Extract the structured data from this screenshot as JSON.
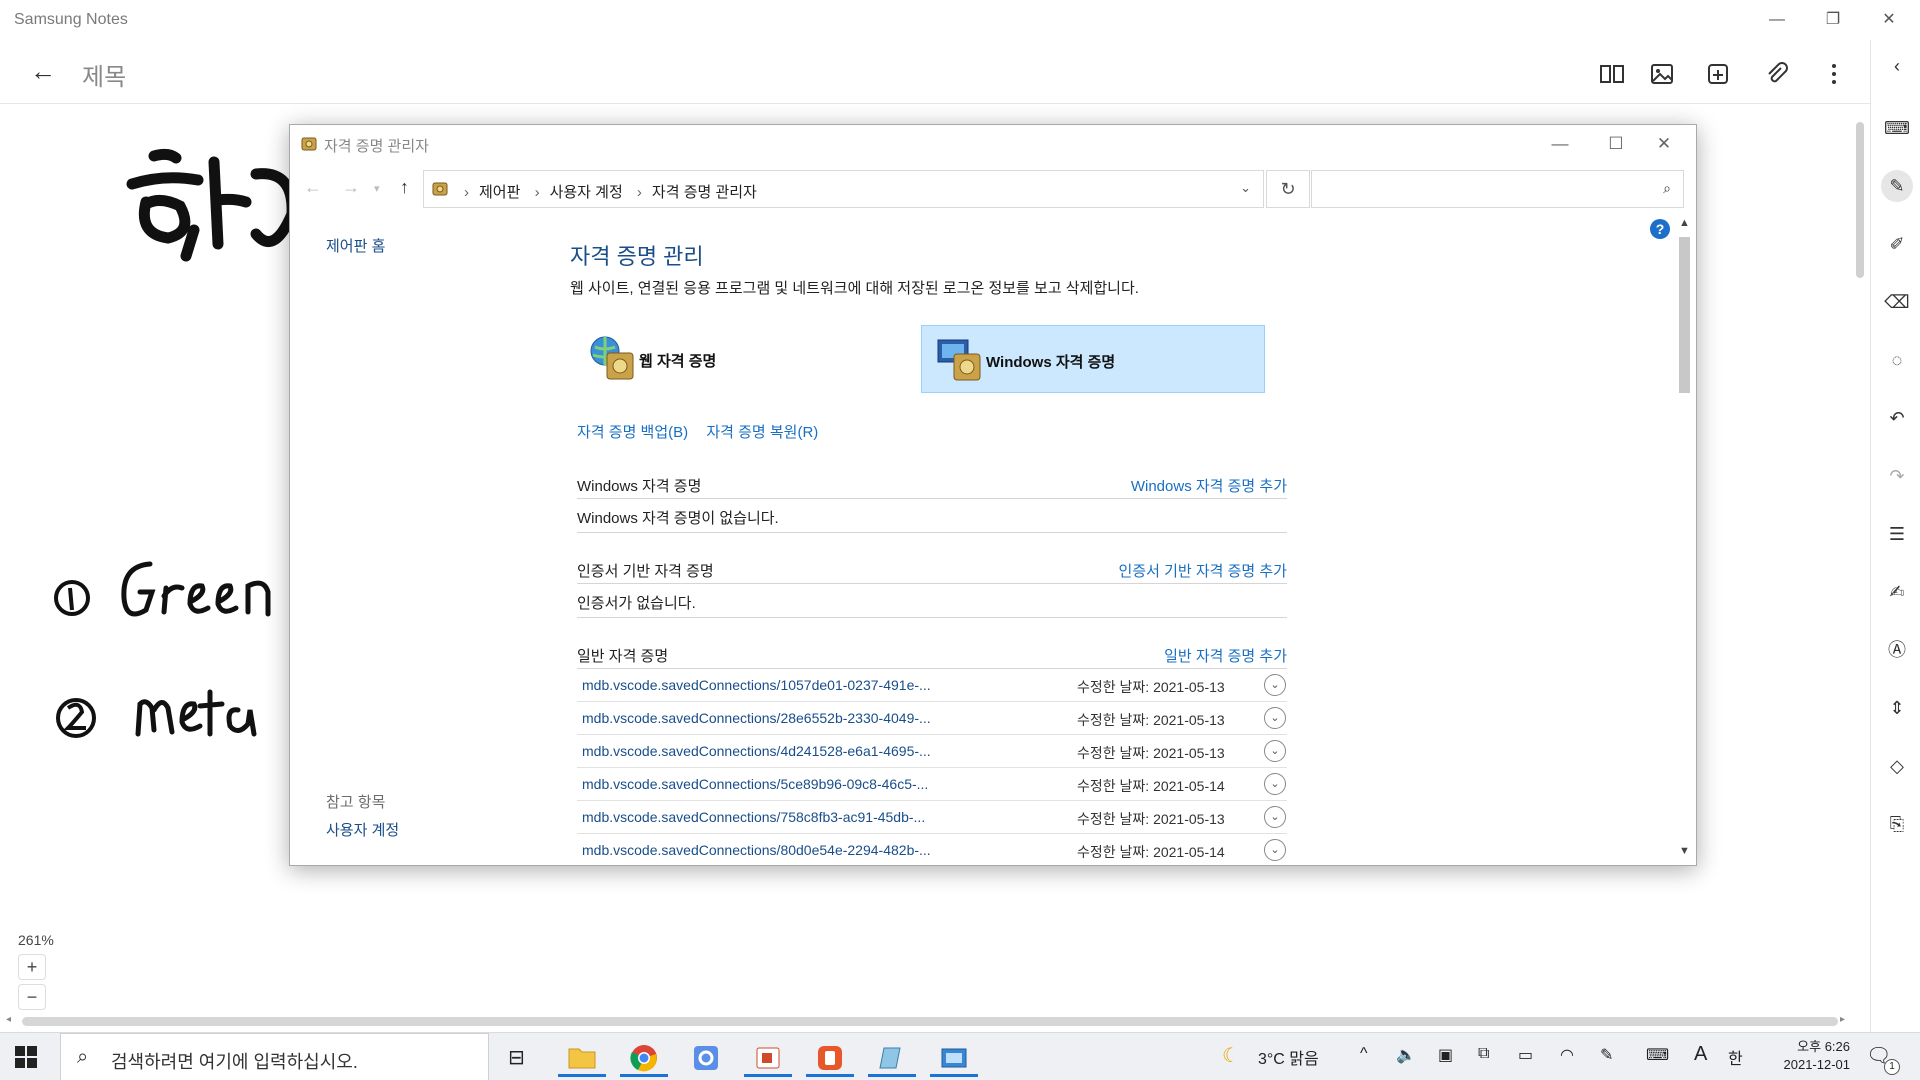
{
  "samsung_notes": {
    "app_title": "Samsung Notes",
    "note_title": "제목",
    "zoom": "261%",
    "zoom_in": "+",
    "zoom_out": "−"
  },
  "credential_manager": {
    "window_title": "자격 증명 관리자",
    "breadcrumb": [
      "제어판",
      "사용자 계정",
      "자격 증명 관리자"
    ],
    "search_placeholder": "",
    "left": {
      "home": "제어판 홈",
      "see_also": "참고 항목",
      "user_accounts": "사용자 계정"
    },
    "heading": "자격 증명 관리",
    "description": "웹 사이트, 연결된 응용 프로그램 및 네트워크에 대해 저장된 로그온 정보를 보고 삭제합니다.",
    "tiles": [
      {
        "label": "웹 자격 증명",
        "selected": false
      },
      {
        "label": "Windows 자격 증명",
        "selected": true
      }
    ],
    "links": {
      "backup": "자격 증명 백업(B)",
      "restore": "자격 증명 복원(R)"
    },
    "windows_section": {
      "title": "Windows 자격 증명",
      "add": "Windows 자격 증명 추가",
      "empty": "Windows 자격 증명이 없습니다."
    },
    "cert_section": {
      "title": "인증서 기반 자격 증명",
      "add": "인증서 기반 자격 증명 추가",
      "empty": "인증서가 없습니다."
    },
    "generic_section": {
      "title": "일반 자격 증명",
      "add": "일반 자격 증명 추가",
      "modified_label": "수정한 날짜:",
      "items": [
        {
          "name": "mdb.vscode.savedConnections/1057de01-0237-491e-...",
          "date": "2021-05-13"
        },
        {
          "name": "mdb.vscode.savedConnections/28e6552b-2330-4049-...",
          "date": "2021-05-13"
        },
        {
          "name": "mdb.vscode.savedConnections/4d241528-e6a1-4695-...",
          "date": "2021-05-13"
        },
        {
          "name": "mdb.vscode.savedConnections/5ce89b96-09c8-46c5-...",
          "date": "2021-05-14"
        },
        {
          "name": "mdb.vscode.savedConnections/758c8fb3-ac91-45db-...",
          "date": "2021-05-13"
        },
        {
          "name": "mdb.vscode.savedConnections/80d0e54e-2294-482b-...",
          "date": "2021-05-14"
        }
      ]
    }
  },
  "taskbar": {
    "search_placeholder": "검색하려면 여기에 입력하십시오.",
    "weather": "3°C 맑음",
    "ime_a": "A",
    "ime_han": "한",
    "time": "오후 6:26",
    "date": "2021-12-01",
    "notification_count": "1"
  },
  "colors": {
    "accent_blue": "#1a6fc3",
    "heading_blue": "#1a4e8a",
    "selected_tile": "#cce8ff"
  }
}
